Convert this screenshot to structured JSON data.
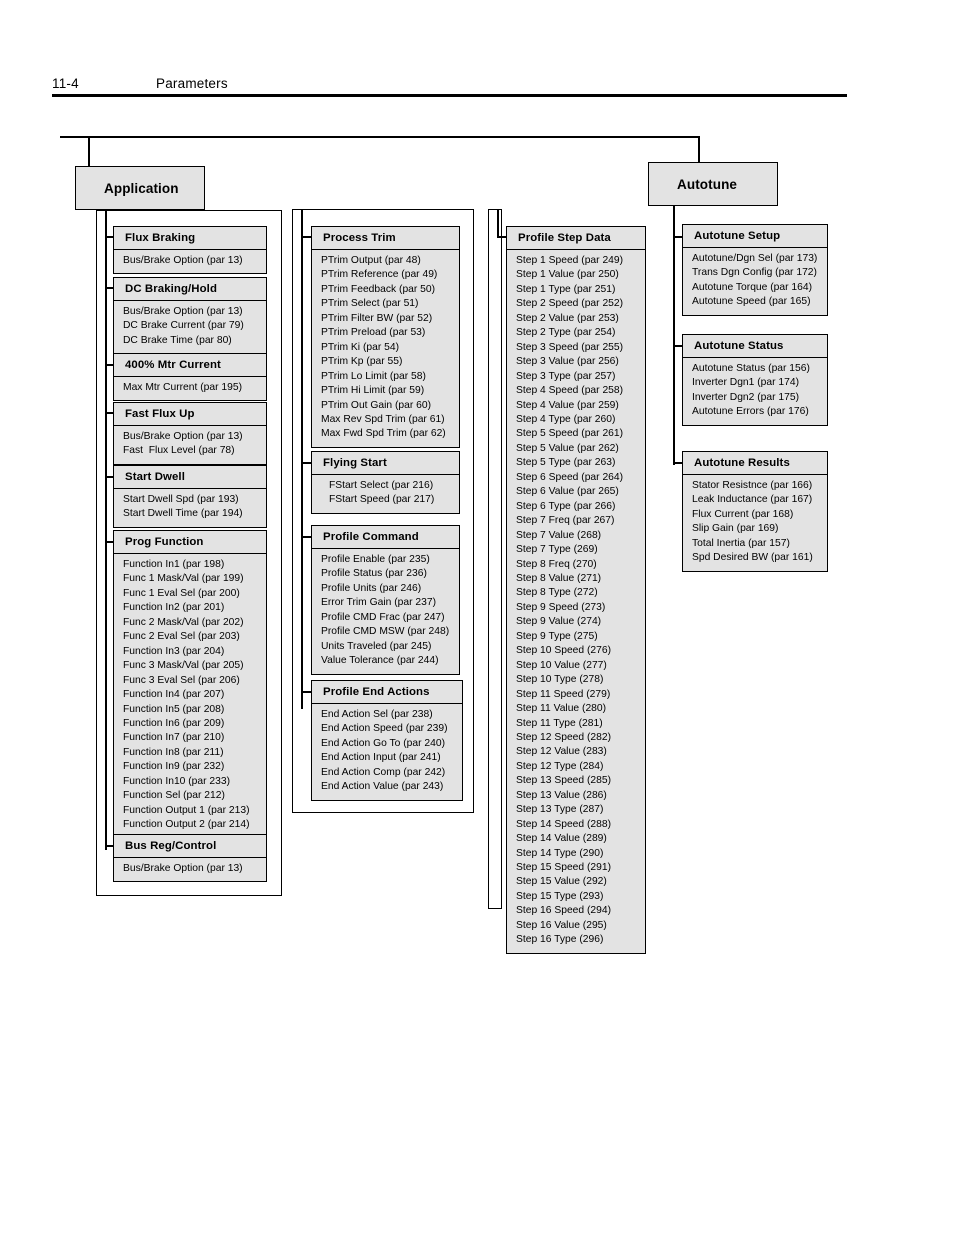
{
  "page": {
    "folio": "11-4",
    "chapter_title": "Parameters"
  },
  "diagram": {
    "top_nodes": [
      {
        "id": "application",
        "label": "Application"
      },
      {
        "id": "autotune",
        "label": "Autotune"
      }
    ],
    "groups": {
      "flux_braking": {
        "title": "Flux Braking",
        "items": [
          "Bus/Brake Option (par 13)"
        ]
      },
      "dc_braking_hold": {
        "title": "DC Braking/Hold",
        "items": [
          "Bus/Brake Option (par 13)",
          "DC Brake Current (par 79)",
          "DC Brake Time (par 80)"
        ]
      },
      "mtr_current_400": {
        "title": "400% Mtr Current",
        "items": [
          "Max Mtr Current (par 195)"
        ]
      },
      "fast_flux_up": {
        "title": "Fast Flux Up",
        "items": [
          "Bus/Brake Option (par 13)",
          "Fast  Flux Level (par 78)"
        ]
      },
      "start_dwell": {
        "title": "Start Dwell",
        "items": [
          "Start Dwell Spd (par 193)",
          "Start Dwell Time (par 194)"
        ]
      },
      "prog_function": {
        "title": "Prog Function",
        "items": [
          "Function In1 (par 198)",
          "Func 1 Mask/Val (par 199)",
          "Func 1 Eval Sel (par 200)",
          "Function In2 (par 201)",
          "Func 2 Mask/Val (par 202)",
          "Func 2 Eval Sel (par 203)",
          "Function In3 (par 204)",
          "Func 3 Mask/Val (par 205)",
          "Func 3 Eval Sel (par 206)",
          "Function In4 (par 207)",
          "Function In5 (par 208)",
          "Function In6 (par 209)",
          "Function In7 (par 210)",
          "Function In8 (par 211)",
          "Function In9 (par 232)",
          "Function In10 (par 233)",
          "Function Sel (par 212)",
          "Function Output 1 (par 213)",
          "Function Output 2 (par 214)"
        ]
      },
      "bus_reg_control": {
        "title": "Bus Reg/Control",
        "items": [
          "Bus/Brake Option (par 13)"
        ]
      },
      "process_trim": {
        "title": "Process Trim",
        "items": [
          "PTrim Output (par 48)",
          "PTrim Reference (par 49)",
          "PTrim Feedback (par 50)",
          "PTrim Select (par 51)",
          "PTrim Filter BW (par 52)",
          "PTrim Preload (par 53)",
          "PTrim Ki (par 54)",
          "PTrim Kp (par 55)",
          "PTrim Lo Limit (par 58)",
          "PTrim Hi Limit (par 59)",
          "PTrim Out Gain (par 60)",
          "Max Rev Spd Trim (par 61)",
          "Max Fwd Spd Trim (par 62)"
        ]
      },
      "flying_start": {
        "title": "Flying Start",
        "items": [
          "FStart Select (par 216)",
          "FStart Speed (par 217)"
        ]
      },
      "profile_command": {
        "title": "Profile Command",
        "items": [
          "Profile Enable (par 235)",
          "Profile Status (par 236)",
          "Profile Units (par 246)",
          "Error Trim Gain (par 237)",
          "Profile CMD Frac (par 247)",
          "Profile CMD MSW (par 248)",
          "Units Traveled (par 245)",
          "Value Tolerance (par 244)"
        ]
      },
      "profile_end_actions": {
        "title": "Profile End Actions",
        "items": [
          "End Action Sel (par 238)",
          "End Action Speed (par 239)",
          "End Action Go To (par 240)",
          "End Action Input (par 241)",
          "End Action Comp (par 242)",
          "End Action Value (par 243)"
        ]
      },
      "profile_step_data": {
        "title": "Profile Step Data",
        "items": [
          "Step 1 Speed (par 249)",
          "Step 1 Value (par 250)",
          "Step 1 Type (par 251)",
          "Step 2 Speed (par 252)",
          "Step 2 Value (par 253)",
          "Step 2 Type (par 254)",
          "Step 3 Speed (par 255)",
          "Step 3 Value (par 256)",
          "Step 3 Type (par 257)",
          "Step 4 Speed (par 258)",
          "Step 4 Value (par 259)",
          "Step 4 Type (par 260)",
          "Step 5 Speed (par 261)",
          "Step 5 Value (par 262)",
          "Step 5 Type (par 263)",
          "Step 6 Speed (par 264)",
          "Step 6 Value (par 265)",
          "Step 6 Type (par 266)",
          "Step 7 Freq (par 267)",
          "Step 7 Value (268)",
          "Step 7 Type (269)",
          "Step 8 Freq (270)",
          "Step 8 Value (271)",
          "Step 8 Type (272)",
          "Step 9 Speed (273)",
          "Step 9 Value (274)",
          "Step 9 Type (275)",
          "Step 10 Speed (276)",
          "Step 10 Value (277)",
          "Step 10 Type (278)",
          "Step 11 Speed (279)",
          "Step 11 Value (280)",
          "Step 11 Type (281)",
          "Step 12 Speed (282)",
          "Step 12 Value (283)",
          "Step 12 Type (284)",
          "Step 13 Speed (285)",
          "Step 13 Value (286)",
          "Step 13 Type (287)",
          "Step 14 Speed (288)",
          "Step 14 Value (289)",
          "Step 14 Type (290)",
          "Step 15 Speed (291)",
          "Step 15 Value (292)",
          "Step 15 Type (293)",
          "Step 16 Speed (294)",
          "Step 16 Value (295)",
          "Step 16 Type (296)"
        ]
      },
      "autotune_setup": {
        "title": "Autotune Setup",
        "items": [
          "Autotune/Dgn Sel (par 173)",
          "Trans Dgn Config (par 172)",
          "Autotune Torque (par 164)",
          "Autotune Speed (par 165)"
        ]
      },
      "autotune_status": {
        "title": "Autotune Status",
        "items": [
          "Autotune Status (par 156)",
          "Inverter Dgn1 (par 174)",
          "Inverter Dgn2 (par 175)",
          "Autotune Errors (par 176)"
        ]
      },
      "autotune_results": {
        "title": "Autotune Results",
        "items": [
          "Stator Resistnce (par 166)",
          "Leak Inductance (par 167)",
          "Flux Current (par 168)",
          "Slip Gain (par 169)",
          "Total Inertia (par 157)",
          "Spd Desired BW (par 161)"
        ]
      }
    },
    "colors": {
      "box_fill": "#e3e3e3",
      "line": "#000000",
      "text": "#000000"
    }
  }
}
